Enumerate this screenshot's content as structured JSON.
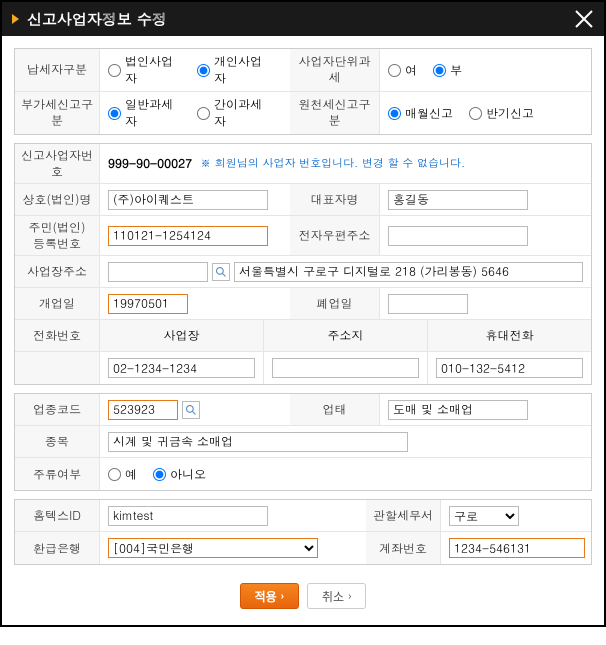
{
  "title": "신고사업자정보 수정",
  "section1": {
    "taxpayer_type_label": "납세자구분",
    "taxpayer_corp": "법인사업자",
    "taxpayer_indiv": "개인사업자",
    "closure_label": "사업자단위과세",
    "closure_yes": "여",
    "closure_no": "부",
    "vat_report_label": "부가세신고구분",
    "vat_general": "일반과세자",
    "vat_simple": "간이과세자",
    "withholding_label": "원천세신고구분",
    "withholding_monthly": "매월신고",
    "withholding_half": "반기신고"
  },
  "section2": {
    "biz_no_label": "신고사업자번호",
    "biz_no": "999-90-00027",
    "biz_no_note": "※ 회원님의 사업자 번호입니다. 변경 할 수 없습니다.",
    "company_label": "상호(법인)명",
    "company": "(주)아이퀘스트",
    "ceo_label": "대표자명",
    "ceo": "홍길동",
    "resident_label": "주민(법인)\n등록번호",
    "resident": "110121-1254124",
    "email_label": "전자우편주소",
    "email": "",
    "address_label": "사업장주소",
    "address_code": "",
    "address": "서울특별시 구로구 디지털로 218 (가리봉동) 5646",
    "open_date_label": "개업일",
    "open_date": "19970501",
    "close_date_label": "폐업일",
    "close_date": "",
    "phone_label": "전화번호",
    "phone_office_label": "사업장",
    "phone_home_label": "주소지",
    "phone_mobile_label": "휴대전화",
    "phone_office": "02-1234-1234",
    "phone_home": "",
    "phone_mobile": "010-132-5412"
  },
  "section3": {
    "biz_code_label": "업종코드",
    "biz_code": "523923",
    "biz_type_label": "업태",
    "biz_type": "도매 및 소매업",
    "biz_item_label": "종목",
    "biz_item": "시계 및 귀금속 소매업",
    "liquor_label": "주류여부",
    "liquor_yes": "예",
    "liquor_no": "아니오"
  },
  "section4": {
    "hometax_label": "홈텍스ID",
    "hometax": "kimtest",
    "tax_office_label": "관할세무서",
    "tax_office": "구로",
    "bank_label": "환급은행",
    "bank": "[004]국민은행",
    "account_label": "계좌번호",
    "account": "1234-546131"
  },
  "buttons": {
    "apply": "적용",
    "cancel": "취소"
  }
}
